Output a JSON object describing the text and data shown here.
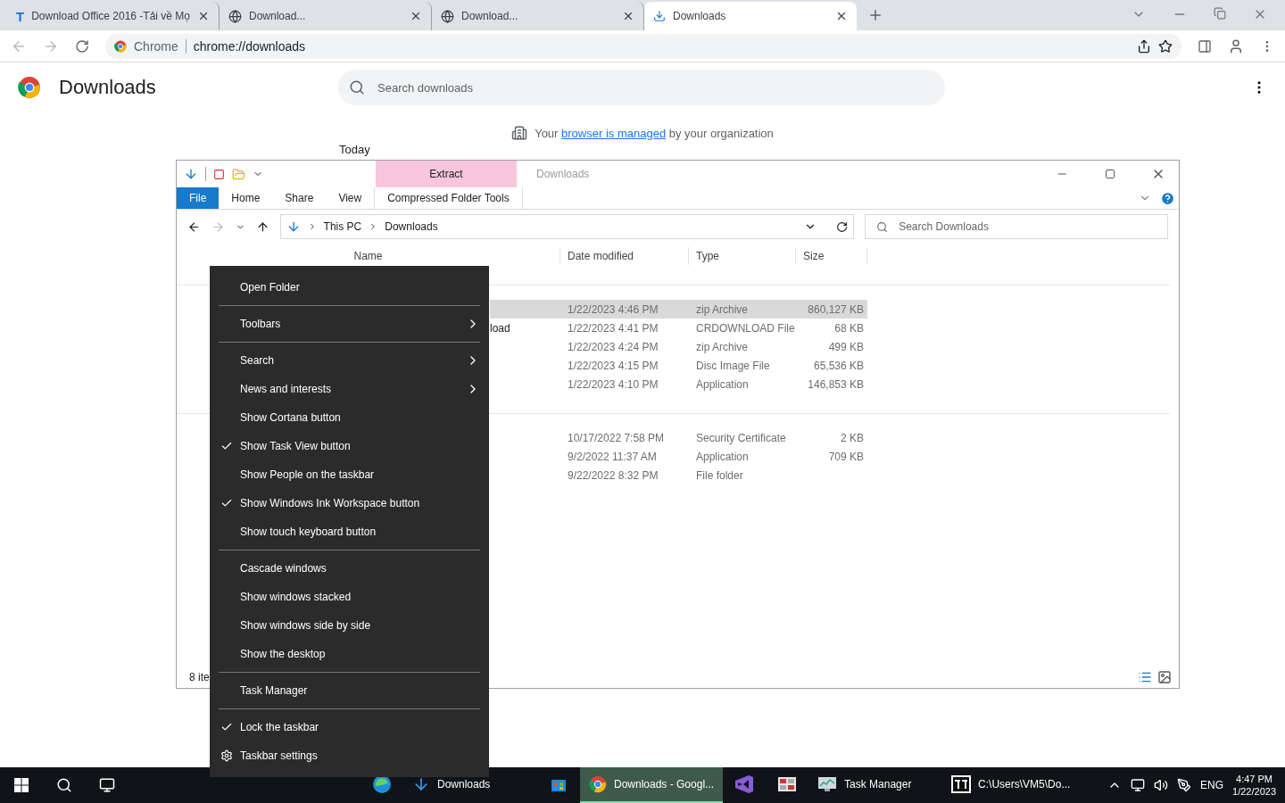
{
  "browser": {
    "tabs": [
      {
        "title": "Download Office 2016 -Tải về Mọ",
        "kind": "letter",
        "glyph": "T",
        "selected": false
      },
      {
        "title": "Download...",
        "kind": "globe",
        "selected": false
      },
      {
        "title": "Download...",
        "kind": "globe",
        "selected": false
      },
      {
        "title": "Downloads",
        "kind": "download",
        "selected": true
      }
    ],
    "omnibox": {
      "site": "Chrome",
      "url": "chrome://downloads"
    }
  },
  "page": {
    "title": "Downloads",
    "search": {
      "placeholder": "Search downloads"
    },
    "notice": {
      "before": "Your",
      "link": "browser is managed",
      "after": "by your organization"
    },
    "section": "Today"
  },
  "explorer": {
    "title": "Downloads",
    "ribbon_tabs": [
      {
        "label": "File",
        "kind": "file",
        "selected": true
      },
      {
        "label": "Home",
        "kind": "tab",
        "selected": false
      },
      {
        "label": "Share",
        "kind": "tab",
        "selected": false
      },
      {
        "label": "View",
        "kind": "tab",
        "selected": false
      },
      {
        "label": "Compressed Folder Tools",
        "kind": "context",
        "selected": false
      }
    ],
    "context_group": "Extract",
    "breadcrumb": [
      "This PC",
      "Downloads"
    ],
    "search": {
      "placeholder": "Search Downloads"
    },
    "columns": [
      "Name",
      "Date modified",
      "Type",
      "Size"
    ],
    "groups": [
      {
        "rows": [
          {
            "date": "1/22/2023 4:46 PM",
            "type": "zip Archive",
            "size": "860,127 KB",
            "selected": true
          },
          {
            "name": "load",
            "date": "1/22/2023 4:41 PM",
            "type": "CRDOWNLOAD File",
            "size": "68 KB",
            "selected": false
          },
          {
            "date": "1/22/2023 4:24 PM",
            "type": "zip Archive",
            "size": "499 KB",
            "selected": false
          },
          {
            "date": "1/22/2023 4:15 PM",
            "type": "Disc Image File",
            "size": "65,536 KB",
            "selected": false
          },
          {
            "date": "1/22/2023 4:10 PM",
            "type": "Application",
            "size": "146,853 KB",
            "selected": false
          }
        ]
      },
      {
        "rows": [
          {
            "date": "10/17/2022 7:58 PM",
            "type": "Security Certificate",
            "size": "2 KB",
            "selected": false
          },
          {
            "date": "9/2/2022 11:37 AM",
            "type": "Application",
            "size": "709 KB",
            "selected": false
          },
          {
            "date": "9/22/2022 8:32 PM",
            "type": "File folder",
            "selected": false
          }
        ]
      }
    ],
    "status": "8 ite"
  },
  "context_menu": [
    {
      "kind": "item",
      "label": "Open Folder",
      "checked": false
    },
    {
      "kind": "separator"
    },
    {
      "kind": "submenu",
      "label": "Toolbars",
      "checked": false
    },
    {
      "kind": "separator"
    },
    {
      "kind": "submenu",
      "label": "Search",
      "checked": false
    },
    {
      "kind": "submenu",
      "label": "News and interests",
      "checked": false
    },
    {
      "kind": "item",
      "label": "Show Cortana button",
      "checked": false
    },
    {
      "kind": "item",
      "label": "Show Task View button",
      "checked": true
    },
    {
      "kind": "item",
      "label": "Show People on the taskbar",
      "checked": false
    },
    {
      "kind": "item",
      "label": "Show Windows Ink Workspace button",
      "checked": true
    },
    {
      "kind": "item",
      "label": "Show touch keyboard button",
      "checked": false
    },
    {
      "kind": "separator"
    },
    {
      "kind": "item",
      "label": "Cascade windows",
      "checked": false
    },
    {
      "kind": "item",
      "label": "Show windows stacked",
      "checked": false
    },
    {
      "kind": "item",
      "label": "Show windows side by side",
      "checked": false
    },
    {
      "kind": "item",
      "label": "Show the desktop",
      "checked": false
    },
    {
      "kind": "separator"
    },
    {
      "kind": "item",
      "label": "Task Manager",
      "checked": false
    },
    {
      "kind": "separator"
    },
    {
      "kind": "item",
      "label": "Lock the taskbar",
      "checked": true
    },
    {
      "kind": "settings",
      "label": "Taskbar settings",
      "checked": false
    }
  ],
  "taskbar": {
    "apps": [
      {
        "kind": "edge",
        "active": false
      },
      {
        "kind": "explorer",
        "label": "Downloads",
        "active": false
      },
      {
        "kind": "store",
        "active": false
      },
      {
        "kind": "chrome",
        "label": "Downloads - Googl...",
        "active": true
      },
      {
        "kind": "vs",
        "active": false
      },
      {
        "kind": "app",
        "active": false
      },
      {
        "kind": "taskmgr",
        "label": "Task Manager",
        "active": false
      },
      {
        "kind": "zip",
        "label": "C:\\Users\\VM5\\Do...",
        "active": false
      }
    ],
    "language": "ENG",
    "time": "4:47 PM",
    "date": "1/22/2023"
  }
}
